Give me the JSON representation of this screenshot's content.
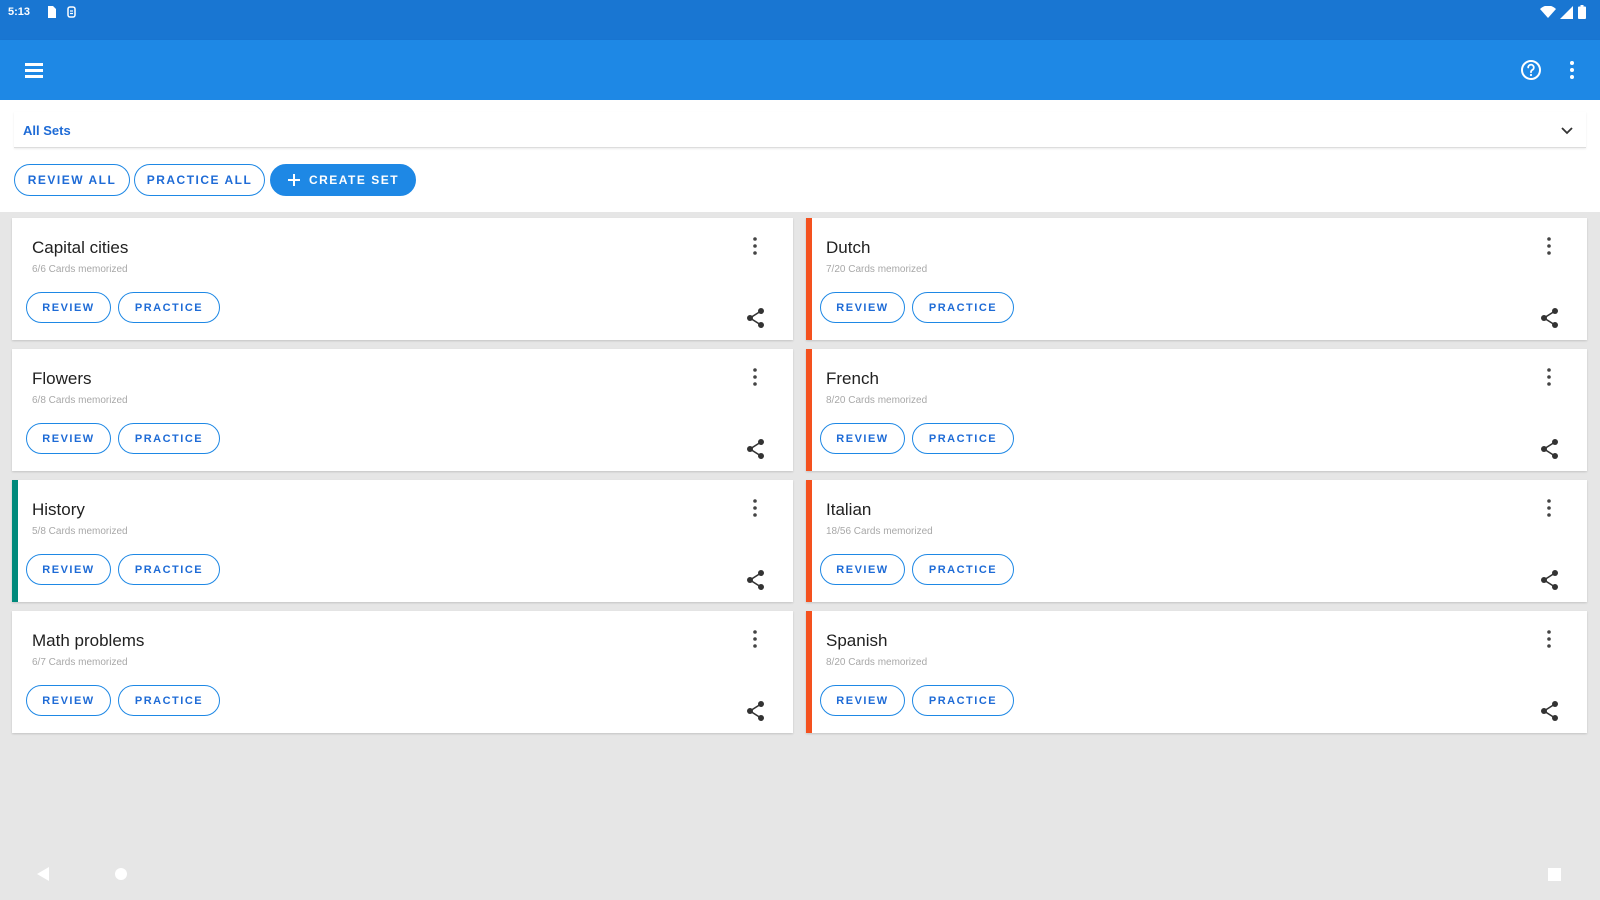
{
  "status_bar": {
    "time": "5:13"
  },
  "colors": {
    "primary": "#1e88e5",
    "status": "#1976d2",
    "accent_orange": "#f4511e",
    "accent_teal": "#00897b"
  },
  "icons": [
    "menu-icon",
    "help-icon",
    "more-vert-icon",
    "chevron-down-icon",
    "plus-icon",
    "share-icon",
    "back-icon",
    "home-icon",
    "recents-icon"
  ],
  "filter": {
    "selected": "All Sets"
  },
  "actions": {
    "review_all": "REVIEW ALL",
    "practice_all": "PRACTICE ALL",
    "create_set": "CREATE SET"
  },
  "card_buttons": {
    "review": "REVIEW",
    "practice": "PRACTICE"
  },
  "cards": [
    {
      "title": "Capital cities",
      "subtitle": "6/6 Cards memorized",
      "accent": "none"
    },
    {
      "title": "Flowers",
      "subtitle": "6/8 Cards memorized",
      "accent": "none"
    },
    {
      "title": "History",
      "subtitle": "5/8 Cards memorized",
      "accent": "teal"
    },
    {
      "title": "Math problems",
      "subtitle": "6/7 Cards memorized",
      "accent": "none"
    },
    {
      "title": "Dutch",
      "subtitle": "7/20 Cards memorized",
      "accent": "orange"
    },
    {
      "title": "French",
      "subtitle": "8/20 Cards memorized",
      "accent": "orange"
    },
    {
      "title": "Italian",
      "subtitle": "18/56 Cards memorized",
      "accent": "orange"
    },
    {
      "title": "Spanish",
      "subtitle": "8/20 Cards memorized",
      "accent": "orange"
    }
  ]
}
